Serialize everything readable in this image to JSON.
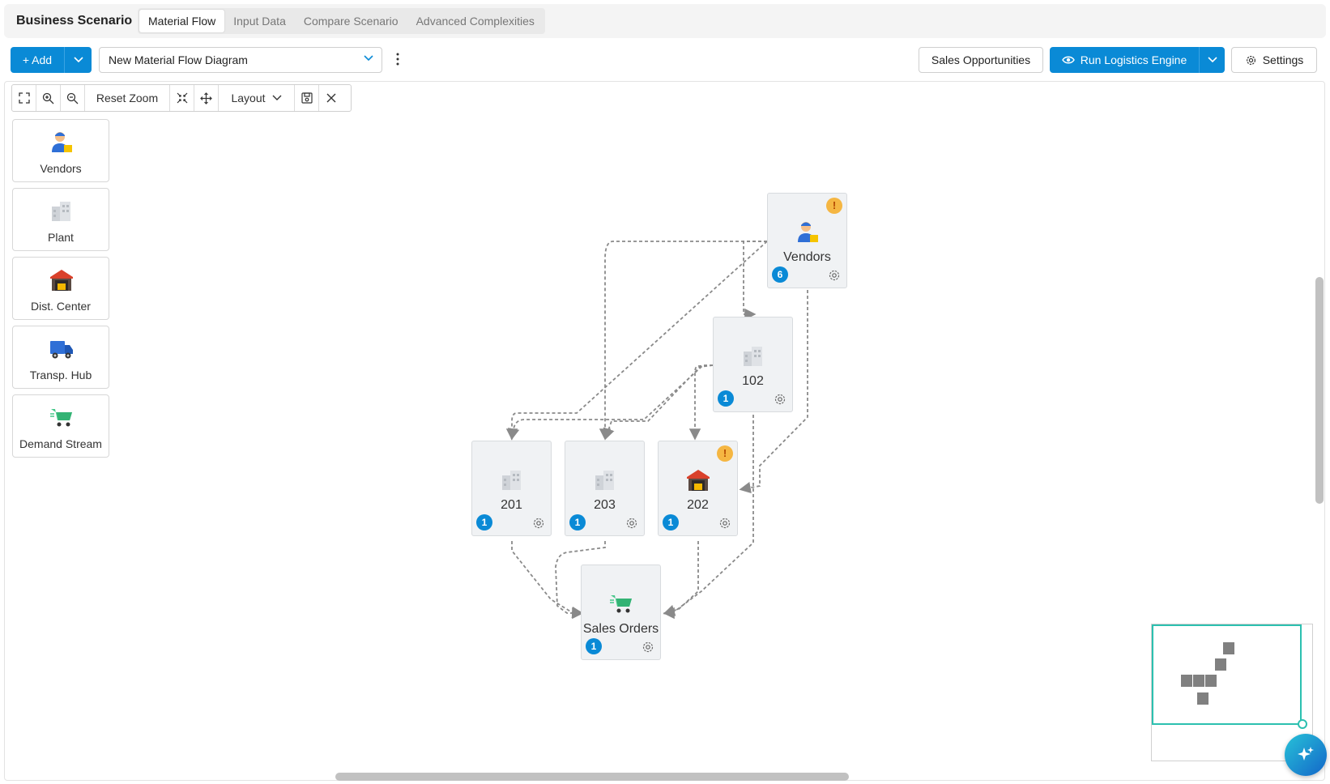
{
  "app": {
    "title": "Business Scenario"
  },
  "tabs": [
    {
      "label": "Material Flow",
      "active": true
    },
    {
      "label": "Input Data",
      "active": false
    },
    {
      "label": "Compare Scenario",
      "active": false
    },
    {
      "label": "Advanced Complexities",
      "active": false
    }
  ],
  "actions": {
    "add_label": "+ Add",
    "diagram_select_value": "New Material Flow Diagram",
    "sales_opportunities_label": "Sales Opportunities",
    "run_engine_label": "Run Logistics Engine",
    "settings_label": "Settings"
  },
  "toolbar": {
    "reset_zoom_label": "Reset Zoom",
    "layout_label": "Layout"
  },
  "palette": [
    {
      "label": "Vendors",
      "icon": "vendor-icon"
    },
    {
      "label": "Plant",
      "icon": "plant-icon"
    },
    {
      "label": "Dist. Center",
      "icon": "warehouse-icon"
    },
    {
      "label": "Transp. Hub",
      "icon": "truck-icon"
    },
    {
      "label": "Demand Stream",
      "icon": "cart-icon"
    }
  ],
  "nodes": {
    "vendors": {
      "label": "Vendors",
      "count": "6",
      "warning": "!",
      "icon": "vendor-icon"
    },
    "n102": {
      "label": "102",
      "count": "1",
      "icon": "plant-icon"
    },
    "n201": {
      "label": "201",
      "count": "1",
      "icon": "plant-icon"
    },
    "n203": {
      "label": "203",
      "count": "1",
      "icon": "plant-icon"
    },
    "n202": {
      "label": "202",
      "count": "1",
      "warning": "!",
      "icon": "warehouse-icon"
    },
    "sales_orders": {
      "label": "Sales Orders",
      "count": "1",
      "icon": "cart-icon"
    }
  },
  "colors": {
    "primary": "#0a8ad6",
    "warning": "#f5b642",
    "minimap_viewport": "#2cc0b0",
    "edge": "#8a8a8a"
  }
}
